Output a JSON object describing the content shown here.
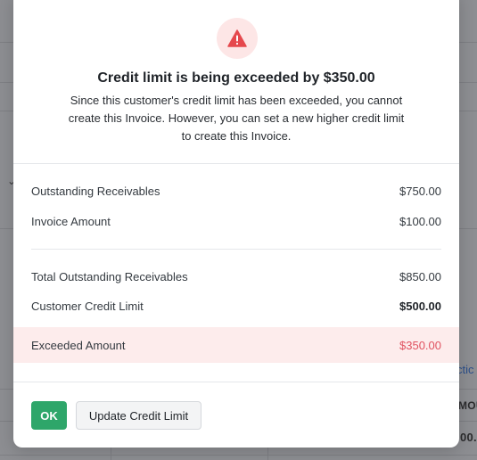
{
  "background": {
    "link_text": "ctic",
    "col_header": "MOU",
    "cell_value": "00."
  },
  "dialog": {
    "icon": "warning-triangle-icon",
    "title": "Credit limit is being exceeded by $350.00",
    "description": "Since this customer's credit limit has been exceeded, you cannot create this Invoice. However, you can set a new higher credit limit to create this Invoice.",
    "rows": [
      {
        "label": "Outstanding Receivables",
        "value": "$750.00"
      },
      {
        "label": "Invoice Amount",
        "value": "$100.00"
      },
      {
        "label": "Total Outstanding Receivables",
        "value": "$850.00"
      },
      {
        "label": "Customer Credit Limit",
        "value": "$500.00"
      }
    ],
    "exceeded": {
      "label": "Exceeded Amount",
      "value": "$350.00"
    },
    "ok_label": "OK",
    "update_label": "Update Credit Limit",
    "colors": {
      "danger": "#e05260",
      "danger_bg": "#fdecec",
      "primary": "#2ea66a"
    }
  }
}
